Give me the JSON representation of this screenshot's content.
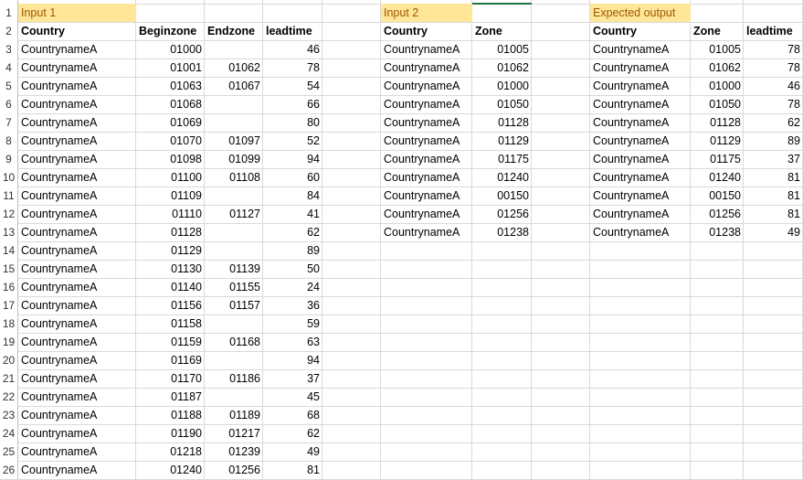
{
  "rows": [
    "1",
    "2",
    "3",
    "4",
    "5",
    "6",
    "7",
    "8",
    "9",
    "10",
    "11",
    "12",
    "13",
    "14",
    "15",
    "16",
    "17",
    "18",
    "19",
    "20",
    "21",
    "22",
    "23",
    "24",
    "25",
    "26"
  ],
  "input1": {
    "title": "Input 1",
    "headers": [
      "Country",
      "Beginzone",
      "Endzone",
      "leadtime"
    ],
    "data": [
      [
        "CountrynameA",
        "01000",
        "",
        "46"
      ],
      [
        "CountrynameA",
        "01001",
        "01062",
        "78"
      ],
      [
        "CountrynameA",
        "01063",
        "01067",
        "54"
      ],
      [
        "CountrynameA",
        "01068",
        "",
        "66"
      ],
      [
        "CountrynameA",
        "01069",
        "",
        "80"
      ],
      [
        "CountrynameA",
        "01070",
        "01097",
        "52"
      ],
      [
        "CountrynameA",
        "01098",
        "01099",
        "94"
      ],
      [
        "CountrynameA",
        "01100",
        "01108",
        "60"
      ],
      [
        "CountrynameA",
        "01109",
        "",
        "84"
      ],
      [
        "CountrynameA",
        "01110",
        "01127",
        "41"
      ],
      [
        "CountrynameA",
        "01128",
        "",
        "62"
      ],
      [
        "CountrynameA",
        "01129",
        "",
        "89"
      ],
      [
        "CountrynameA",
        "01130",
        "01139",
        "50"
      ],
      [
        "CountrynameA",
        "01140",
        "01155",
        "24"
      ],
      [
        "CountrynameA",
        "01156",
        "01157",
        "36"
      ],
      [
        "CountrynameA",
        "01158",
        "",
        "59"
      ],
      [
        "CountrynameA",
        "01159",
        "01168",
        "63"
      ],
      [
        "CountrynameA",
        "01169",
        "",
        "94"
      ],
      [
        "CountrynameA",
        "01170",
        "01186",
        "37"
      ],
      [
        "CountrynameA",
        "01187",
        "",
        "45"
      ],
      [
        "CountrynameA",
        "01188",
        "01189",
        "68"
      ],
      [
        "CountrynameA",
        "01190",
        "01217",
        "62"
      ],
      [
        "CountrynameA",
        "01218",
        "01239",
        "49"
      ],
      [
        "CountrynameA",
        "01240",
        "01256",
        "81"
      ]
    ]
  },
  "input2": {
    "title": "Input 2",
    "headers": [
      "Country",
      "Zone"
    ],
    "data": [
      [
        "CountrynameA",
        "01005"
      ],
      [
        "CountrynameA",
        "01062"
      ],
      [
        "CountrynameA",
        "01000"
      ],
      [
        "CountrynameA",
        "01050"
      ],
      [
        "CountrynameA",
        "01128"
      ],
      [
        "CountrynameA",
        "01129"
      ],
      [
        "CountrynameA",
        "01175"
      ],
      [
        "CountrynameA",
        "01240"
      ],
      [
        "CountrynameA",
        "00150"
      ],
      [
        "CountrynameA",
        "01256"
      ],
      [
        "CountrynameA",
        "01238"
      ]
    ]
  },
  "output": {
    "title": "Expected output",
    "headers": [
      "Country",
      "Zone",
      "leadtime"
    ],
    "data": [
      [
        "CountrynameA",
        "01005",
        "78"
      ],
      [
        "CountrynameA",
        "01062",
        "78"
      ],
      [
        "CountrynameA",
        "01000",
        "46"
      ],
      [
        "CountrynameA",
        "01050",
        "78"
      ],
      [
        "CountrynameA",
        "01128",
        "62"
      ],
      [
        "CountrynameA",
        "01129",
        "89"
      ],
      [
        "CountrynameA",
        "01175",
        "37"
      ],
      [
        "CountrynameA",
        "01240",
        "81"
      ],
      [
        "CountrynameA",
        "00150",
        "81"
      ],
      [
        "CountrynameA",
        "01256",
        "81"
      ],
      [
        "CountrynameA",
        "01238",
        "49"
      ]
    ]
  },
  "colors": {
    "title_fill": "#ffe699",
    "title_text": "#9c5700",
    "grid": "#d9d9d9",
    "selection": "#217346"
  }
}
